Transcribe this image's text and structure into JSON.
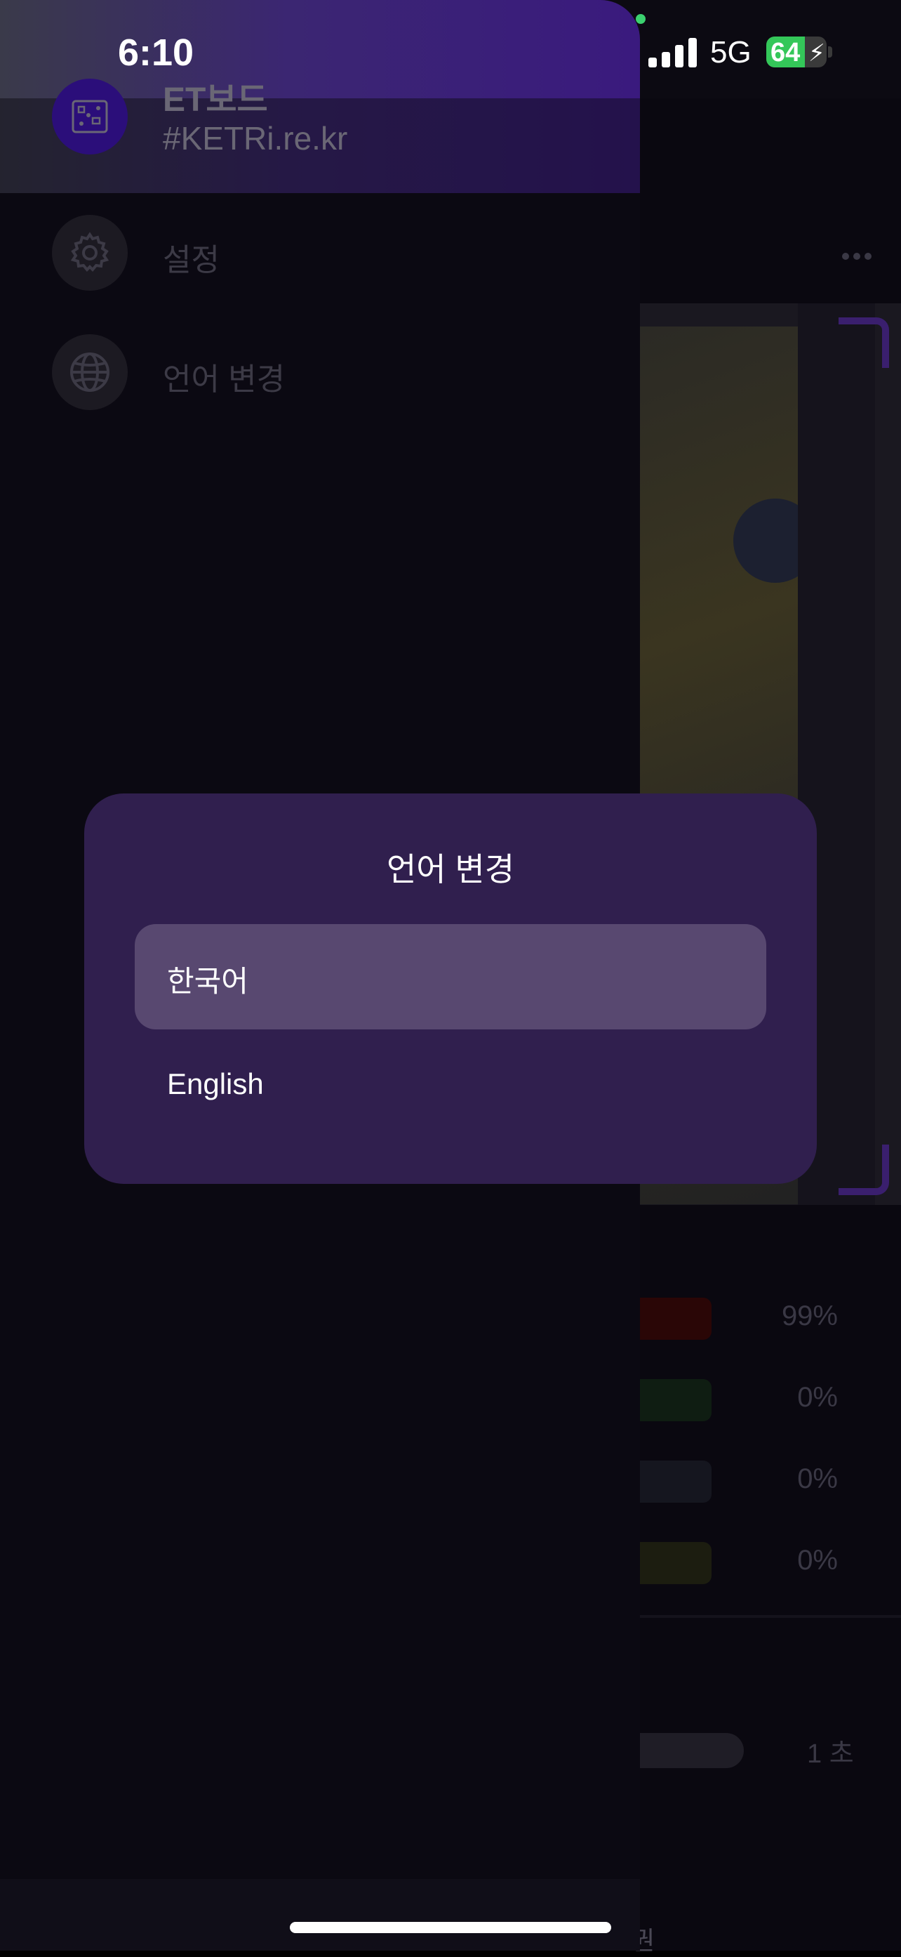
{
  "status_bar": {
    "time": "6:10",
    "network": "5G",
    "battery": "64",
    "battery_level": 0.64
  },
  "drawer": {
    "header": {
      "name": "ET보드",
      "id": "#KETRi.re.kr"
    },
    "menu": [
      {
        "label": "설정",
        "icon": "gear-icon"
      },
      {
        "label": "언어 변경",
        "icon": "globe-icon"
      }
    ]
  },
  "background": {
    "percents": [
      "99%",
      "0%",
      "0%",
      "0%"
    ],
    "bar_colors": [
      "#2a0606",
      "#0f1d12",
      "#15161f",
      "#1c1d10"
    ],
    "time_label": "1 초",
    "bottom_text": "권"
  },
  "dialog": {
    "title": "언어 변경",
    "options": [
      {
        "label": "한국어",
        "selected": true
      },
      {
        "label": "English",
        "selected": false
      }
    ]
  },
  "colors": {
    "accent": "#3a1a7e",
    "dialog_bg": "#301f4e",
    "selected_bg": "#584870"
  }
}
